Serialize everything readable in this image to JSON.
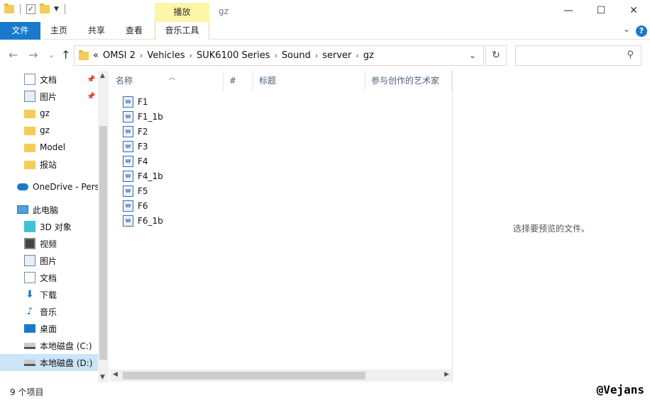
{
  "window": {
    "title": "gz",
    "context_tab": "播放",
    "controls": {
      "minimize": "—",
      "maximize": "☐",
      "close": "✕"
    }
  },
  "ribbon": {
    "tabs": [
      "文件",
      "主页",
      "共享",
      "查看",
      "音乐工具"
    ],
    "help": "?"
  },
  "address": {
    "prefix": "«",
    "crumbs": [
      "OMSI 2",
      "Vehicles",
      "SUK6100 Series",
      "Sound",
      "server",
      "gz"
    ],
    "search_placeholder": ""
  },
  "sidebar": {
    "items": [
      {
        "label": "文档",
        "icon": "document-icon",
        "pinned": true
      },
      {
        "label": "图片",
        "icon": "pictures-icon",
        "pinned": true
      },
      {
        "label": "gz",
        "icon": "folder-icon"
      },
      {
        "label": "gz",
        "icon": "folder-icon"
      },
      {
        "label": "Model",
        "icon": "folder-icon"
      },
      {
        "label": "报站",
        "icon": "folder-icon"
      },
      {
        "label": "OneDrive - Pers",
        "icon": "onedrive-icon"
      },
      {
        "label": "此电脑",
        "icon": "this-pc-icon"
      },
      {
        "label": "3D 对象",
        "icon": "3d-objects-icon"
      },
      {
        "label": "视频",
        "icon": "video-icon"
      },
      {
        "label": "图片",
        "icon": "pictures-icon"
      },
      {
        "label": "文档",
        "icon": "document-icon"
      },
      {
        "label": "下载",
        "icon": "download-icon"
      },
      {
        "label": "音乐",
        "icon": "music-icon"
      },
      {
        "label": "桌面",
        "icon": "desktop-icon"
      },
      {
        "label": "本地磁盘 (C:)",
        "icon": "drive-icon"
      },
      {
        "label": "本地磁盘 (D:)",
        "icon": "drive-icon",
        "selected": true
      }
    ]
  },
  "columns": [
    "名称",
    "#",
    "标题",
    "参与创作的艺术家"
  ],
  "files": [
    "F1",
    "F1_1b",
    "F2",
    "F3",
    "F4",
    "F4_1b",
    "F5",
    "F6",
    "F6_1b"
  ],
  "preview": {
    "message": "选择要预览的文件。"
  },
  "status": {
    "count": "9 个项目"
  },
  "watermark": "@Vejans"
}
